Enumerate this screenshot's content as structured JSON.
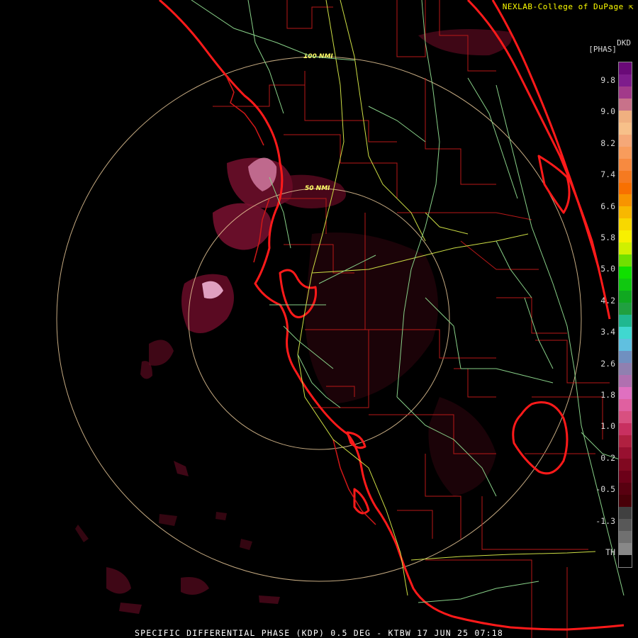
{
  "header": {
    "credit": "NEXLAB-College of DuPage",
    "credit_icon": "arrow-cursor-icon"
  },
  "caption": "SPECIFIC DIFFERENTIAL PHASE (KDP) 0.5 DEG - KTBW 17 JUN 25 07:18",
  "rings": {
    "inner_label": "50 NMI",
    "outer_label": "100 NMI"
  },
  "legend": {
    "product": "DKD",
    "units": "[PHAS]",
    "ticks": [
      "9.8",
      "9.0",
      "8.2",
      "7.4",
      "6.6",
      "5.8",
      "5.0",
      "4.2",
      "3.4",
      "2.6",
      "1.8",
      "1.0",
      "0.2",
      "-0.5",
      "-1.3",
      "TH"
    ],
    "colors": [
      "#6a0a78",
      "#7e1c8c",
      "#a23a8a",
      "#c8728a",
      "#f0b080",
      "#f7c08a",
      "#f5a878",
      "#f89c5c",
      "#f78a40",
      "#f57a20",
      "#f87000",
      "#f89400",
      "#f8b800",
      "#f8d800",
      "#f8f000",
      "#d0f000",
      "#70e000",
      "#10e000",
      "#10c810",
      "#10a820",
      "#20a040",
      "#20b890",
      "#40d8d0",
      "#60c0e0",
      "#7090c0",
      "#9080b0",
      "#b070b0",
      "#e070c0",
      "#e060a0",
      "#d85080",
      "#c83060",
      "#b02040",
      "#981030",
      "#800820",
      "#6c0018",
      "#580010",
      "#480008",
      "#404040",
      "#585858",
      "#707070",
      "#888888",
      "#000000"
    ]
  },
  "colors": {
    "coast": "#ff1a1a",
    "county": "#c01818",
    "highway": "#ccdd44",
    "road": "#88d088",
    "ring": "#e8c898"
  }
}
